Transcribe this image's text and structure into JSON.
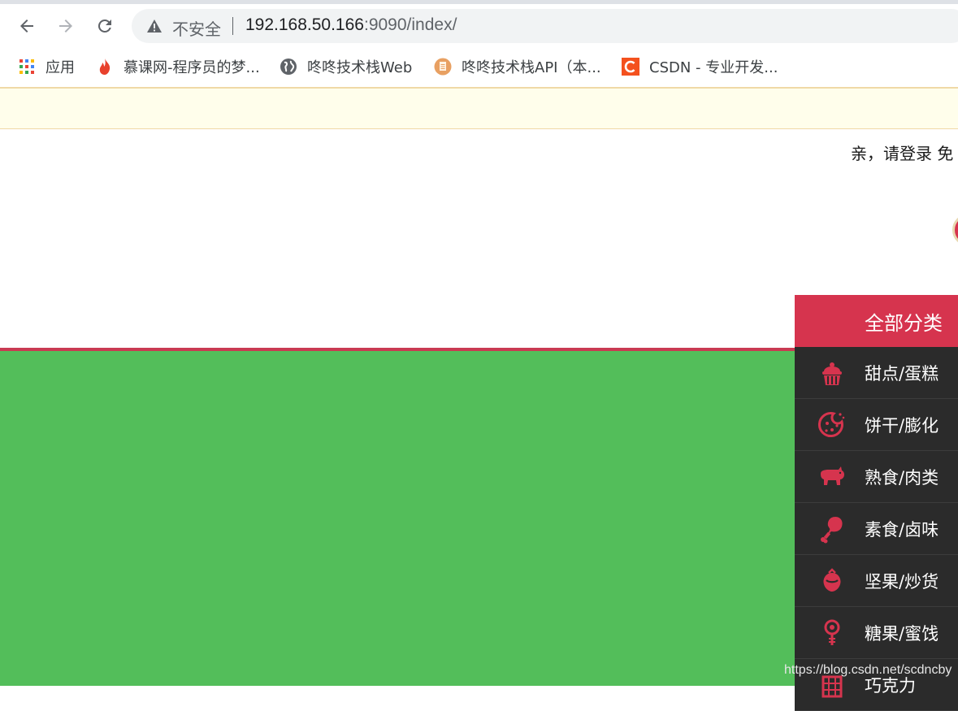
{
  "browser": {
    "security_label": "不安全",
    "url_host": "192.168.50.166",
    "url_rest": ":9090/index/",
    "bookmarks": [
      {
        "label": "应用",
        "icon": "apps-grid-icon"
      },
      {
        "label": "慕课网-程序员的梦...",
        "icon": "flame-icon"
      },
      {
        "label": "咚咚技术栈Web",
        "icon": "globe-icon"
      },
      {
        "label": "咚咚技术栈API（本...",
        "icon": "document-icon"
      },
      {
        "label": "CSDN - 专业开发...",
        "icon": "csdn-logo-icon"
      }
    ]
  },
  "page": {
    "login_prompt": "亲，请登录",
    "register_prompt": "免",
    "category": {
      "header": "全部分类",
      "items": [
        {
          "label": "甜点/蛋糕",
          "icon": "cake-icon"
        },
        {
          "label": "饼干/膨化",
          "icon": "cookie-icon"
        },
        {
          "label": "熟食/肉类",
          "icon": "pig-icon"
        },
        {
          "label": "素食/卤味",
          "icon": "drumstick-icon"
        },
        {
          "label": "坚果/炒货",
          "icon": "nut-icon"
        },
        {
          "label": "糖果/蜜饯",
          "icon": "lollipop-icon"
        },
        {
          "label": "巧克力",
          "icon": "chocolate-icon"
        }
      ]
    },
    "watermark": "https://blog.csdn.net/scdncby"
  },
  "colors": {
    "accent_red": "#d6344e",
    "banner_green": "#53be5a",
    "category_dark": "#2b2b2b",
    "notice_yellow": "#fffeeb"
  }
}
